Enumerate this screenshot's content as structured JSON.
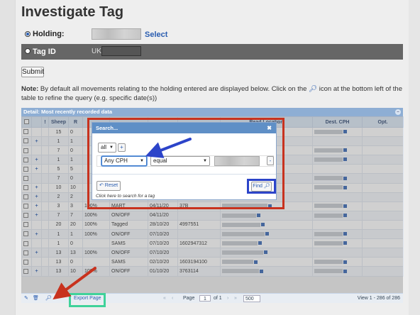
{
  "page": {
    "title": "Investigate Tag"
  },
  "form": {
    "holding_label": "Holding:",
    "select_link": "Select",
    "tagid_label": "Tag ID",
    "tagid_prefix": "UK",
    "submit_label": "Submit"
  },
  "note": {
    "bold": "Note:",
    "text1": "By default all movements relating to the holding entered are displayed below. Click on the",
    "text2": "icon at the bottom left of the table to refine the query (e.g. specific date(s))"
  },
  "grid": {
    "caption": "Detail: Most recently recorded data",
    "columns": [
      "",
      "",
      "!",
      "Sheep",
      "R",
      "",
      "",
      "",
      "",
      "Read Location",
      "Dest. CPH",
      "Opt."
    ],
    "rows": [
      {
        "plus": "",
        "sheep": "15",
        "r": "0",
        "pct": "",
        "type": "",
        "date": "",
        "id": ""
      },
      {
        "plus": "+",
        "sheep": "1",
        "r": "1",
        "pct": "",
        "type": "",
        "date": "",
        "id": ""
      },
      {
        "plus": "",
        "sheep": "7",
        "r": "0",
        "pct": "",
        "type": "",
        "date": "",
        "id": ""
      },
      {
        "plus": "+",
        "sheep": "1",
        "r": "1",
        "pct": "",
        "type": "",
        "date": "",
        "id": ""
      },
      {
        "plus": "+",
        "sheep": "5",
        "r": "5",
        "pct": "",
        "type": "",
        "date": "",
        "id": ""
      },
      {
        "plus": "",
        "sheep": "7",
        "r": "0",
        "pct": "",
        "type": "",
        "date": "",
        "id": ""
      },
      {
        "plus": "+",
        "sheep": "10",
        "r": "10",
        "pct": "",
        "type": "",
        "date": "",
        "id": ""
      },
      {
        "plus": "+",
        "sheep": "2",
        "r": "2",
        "pct": "",
        "type": "",
        "date": "",
        "id": ""
      },
      {
        "plus": "+",
        "sheep": "3",
        "r": "3",
        "pct": "100%",
        "type": "MART",
        "date": "04/11/20",
        "id": "37B"
      },
      {
        "plus": "+",
        "sheep": "7",
        "r": "7",
        "pct": "100%",
        "type": "ON/OFF",
        "date": "04/11/20",
        "id": ""
      },
      {
        "plus": "",
        "sheep": "20",
        "r": "20",
        "pct": "100%",
        "type": "Tagged",
        "date": "28/10/20",
        "id": "4997551"
      },
      {
        "plus": "+",
        "sheep": "1",
        "r": "1",
        "pct": "100%",
        "type": "ON/OFF",
        "date": "07/10/20",
        "id": ""
      },
      {
        "plus": "",
        "sheep": "1",
        "r": "0",
        "pct": "",
        "type": "SAMS",
        "date": "07/10/20",
        "id": "1602947312"
      },
      {
        "plus": "+",
        "sheep": "13",
        "r": "13",
        "pct": "100%",
        "type": "ON/OFF",
        "date": "07/10/20",
        "id": ""
      },
      {
        "plus": "",
        "sheep": "13",
        "r": "0",
        "pct": "",
        "type": "SAMS",
        "date": "02/10/20",
        "id": "1603194100"
      },
      {
        "plus": "+",
        "sheep": "13",
        "r": "10",
        "pct": "100%",
        "type": "ON/OFF",
        "date": "01/10/20",
        "id": "3763114"
      }
    ]
  },
  "pager": {
    "export_label": "Export Page",
    "page_word": "Page",
    "page_value": "1",
    "of_text": "of 1",
    "rows_value": "500",
    "view_text": "View 1 - 286 of 286"
  },
  "dialog": {
    "title": "Search...",
    "close_glyph": "✖",
    "group_op": "all",
    "add_glyph": "+",
    "field": "Any CPH",
    "operator": "equal",
    "remove_glyph": "-",
    "reset_label": "Reset",
    "find_label": "Find",
    "hint": "Click here to search for a tag"
  },
  "colors": {
    "annotation_red": "#c8321e",
    "annotation_blue": "#2c44c9",
    "annotation_green": "#3fd29a",
    "link_blue": "#2a5db0",
    "dialog_header": "#5f8fc6"
  }
}
